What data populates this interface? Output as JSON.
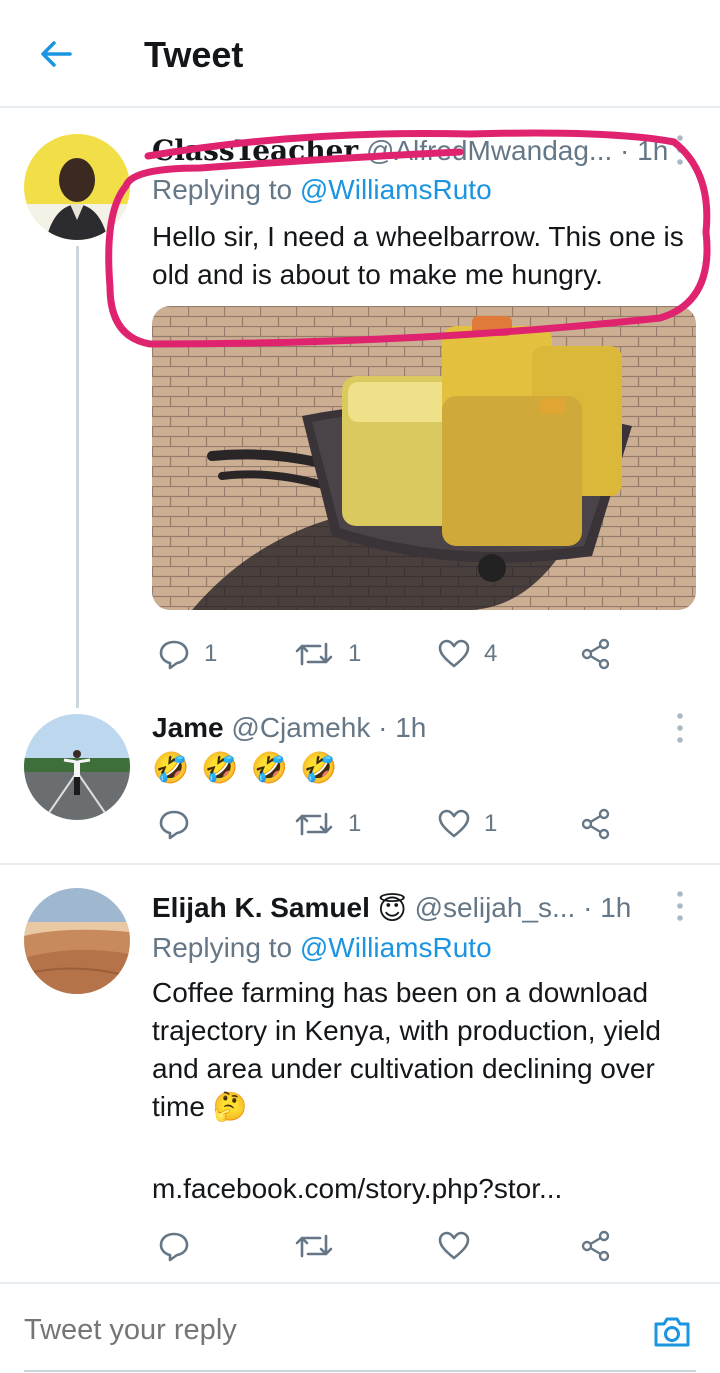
{
  "header": {
    "title": "Tweet"
  },
  "tweets": [
    {
      "display_name": "ClassTeacher",
      "handle": "@AlfredMwandag...",
      "time": "· 1h",
      "replying_prefix": "Replying to",
      "replying_to": "@WilliamsRuto",
      "text": "Hello sir, I need a wheelbarrow. This one is old and is about to make me hungry.",
      "replies": "1",
      "retweets": "1",
      "likes": "4"
    },
    {
      "display_name": "Jame",
      "handle": "@Cjamehk",
      "time": "· 1h",
      "text": "🤣🤣🤣🤣",
      "replies": "",
      "retweets": "1",
      "likes": "1"
    },
    {
      "display_name": "Elijah K. Samuel",
      "name_emoji": "😇",
      "handle": "@selijah_s...",
      "time": "· 1h",
      "replying_prefix": "Replying to",
      "replying_to": "@WilliamsRuto",
      "text": "Coffee farming has been on a download trajectory in Kenya, with production, yield and area under cultivation declining over time",
      "text_emoji": "🤔",
      "link": "m.facebook.com/story.php?stor...",
      "replies": "",
      "retweets": "",
      "likes": ""
    }
  ],
  "reply_box": {
    "placeholder": "Tweet your reply"
  },
  "colors": {
    "accent": "#1b95e0",
    "annotation": "#e0236f"
  },
  "icons": [
    "back-arrow-icon",
    "more-icon",
    "reply-icon",
    "retweet-icon",
    "like-icon",
    "share-icon",
    "camera-icon"
  ]
}
